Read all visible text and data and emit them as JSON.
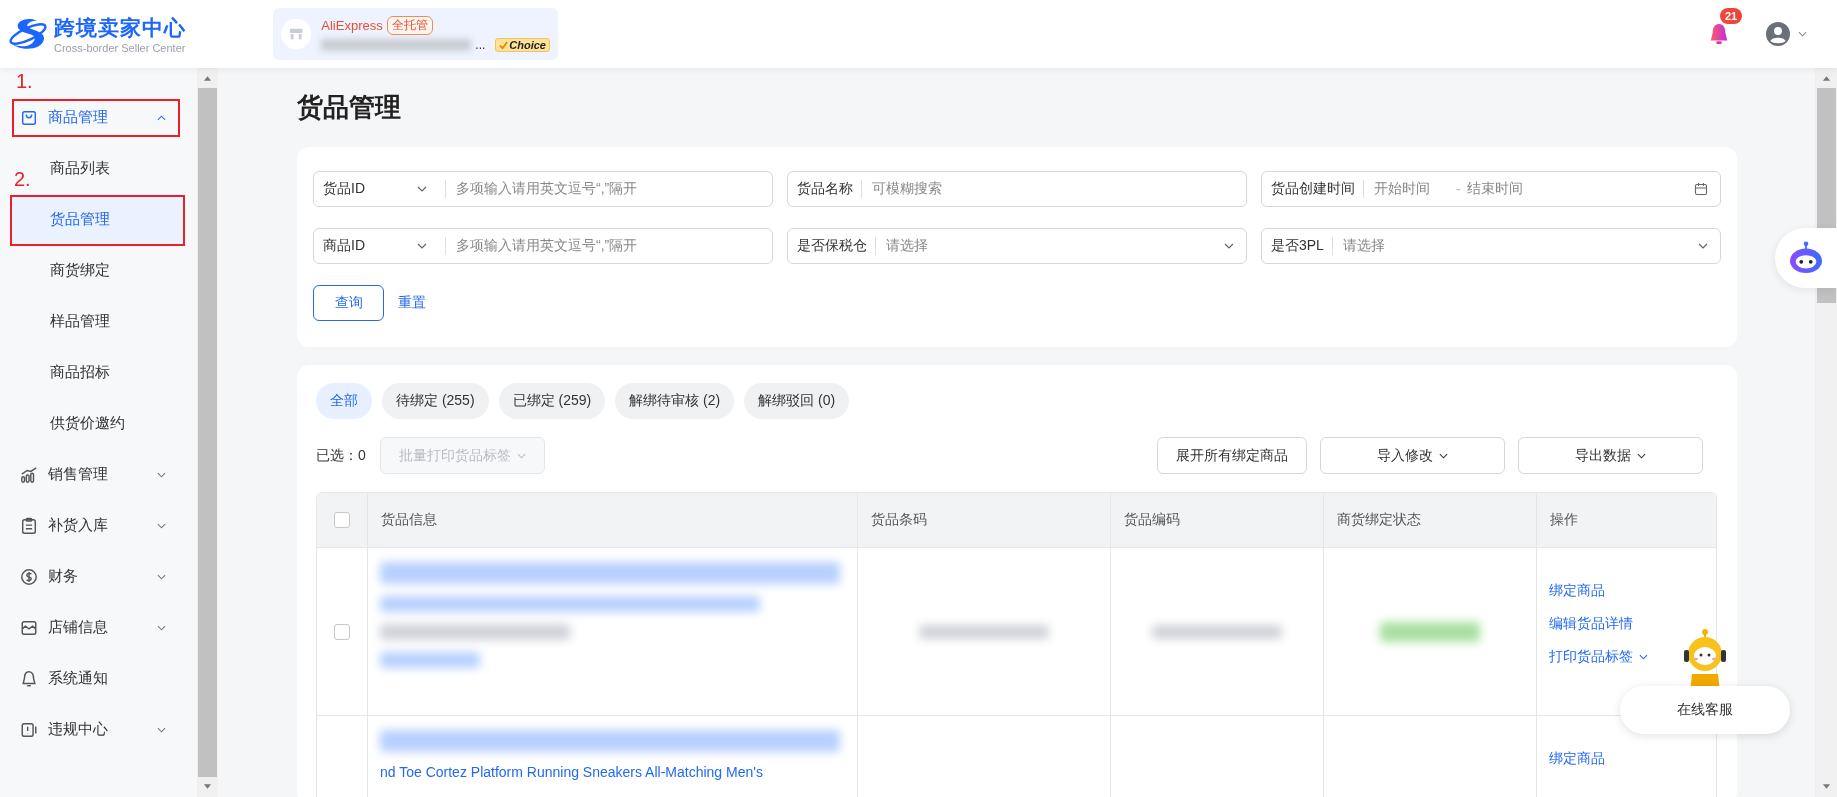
{
  "header": {
    "logo": {
      "title": "跨境卖家中心",
      "subtitle": "Cross-border Seller Center"
    },
    "store": {
      "platform": "AliExpress",
      "badge": "全托管",
      "name_tail": "...",
      "choice": "Choice"
    },
    "notifications": {
      "count": "21"
    }
  },
  "sidebar": {
    "items": [
      {
        "label": "商品管理",
        "kind": "bag",
        "expanded": true,
        "annotation": "1.",
        "children": [
          {
            "label": "商品列表",
            "selected": false
          },
          {
            "label": "货品管理",
            "selected": true,
            "annotation": "2."
          },
          {
            "label": "商货绑定",
            "selected": false
          },
          {
            "label": "样品管理",
            "selected": false
          },
          {
            "label": "商品招标",
            "selected": false
          },
          {
            "label": "供货价邀约",
            "selected": false
          }
        ]
      },
      {
        "label": "销售管理",
        "kind": "chart",
        "expanded": false
      },
      {
        "label": "补货入库",
        "kind": "clipboard",
        "expanded": false
      },
      {
        "label": "财务",
        "kind": "dollar",
        "expanded": false
      },
      {
        "label": "店铺信息",
        "kind": "store",
        "expanded": false
      },
      {
        "label": "系统通知",
        "kind": "bell"
      },
      {
        "label": "违规中心",
        "kind": "alert",
        "expanded": false
      }
    ]
  },
  "page_title": "货品管理",
  "filters": {
    "rows": [
      [
        {
          "kind": "select-input",
          "label": "货品ID",
          "placeholder": "多项输入请用英文逗号“,”隔开"
        },
        {
          "kind": "input",
          "label": "货品名称",
          "placeholder": "可模糊搜索"
        },
        {
          "kind": "date-range",
          "label": "货品创建时间",
          "start": "开始时间",
          "separator": "-",
          "end": "结束时间"
        }
      ],
      [
        {
          "kind": "select-input",
          "label": "商品ID",
          "placeholder": "多项输入请用英文逗号“,”隔开"
        },
        {
          "kind": "select",
          "label": "是否保税仓",
          "placeholder": "请选择"
        },
        {
          "kind": "select",
          "label": "是否3PL",
          "placeholder": "请选择"
        }
      ]
    ],
    "search_button": "查询",
    "reset_link": "重置"
  },
  "tabs": [
    {
      "label": "全部",
      "selected": true
    },
    {
      "label": "待绑定 (255)",
      "selected": false
    },
    {
      "label": "已绑定 (259)",
      "selected": false
    },
    {
      "label": "解绑待审核 (2)",
      "selected": false
    },
    {
      "label": "解绑驳回 (0)",
      "selected": false
    }
  ],
  "toolbar": {
    "selected_count": "已选：0",
    "batch_print": {
      "label": "批量打印货品标签",
      "disabled": true
    },
    "buttons": [
      {
        "label": "展开所有绑定商品",
        "dropdown": false
      },
      {
        "label": "导入修改",
        "dropdown": true
      },
      {
        "label": "导出数据",
        "dropdown": true
      }
    ]
  },
  "table": {
    "select_all_checked": false,
    "columns": [
      "货品信息",
      "货品条码",
      "货品编码",
      "商货绑定状态",
      "操作"
    ],
    "rows": [
      {
        "checked": false,
        "actions": [
          {
            "label": "绑定商品",
            "dropdown": false
          },
          {
            "label": "编辑货品详情",
            "dropdown": false
          },
          {
            "label": "打印货品标签",
            "dropdown": true
          }
        ]
      },
      {
        "title": "nd Toe Cortez Platform Running Sneakers All-Matching Men's",
        "actions": [
          {
            "label": "绑定商品",
            "dropdown": false
          }
        ]
      }
    ]
  },
  "chat": {
    "label": "在线客服"
  }
}
